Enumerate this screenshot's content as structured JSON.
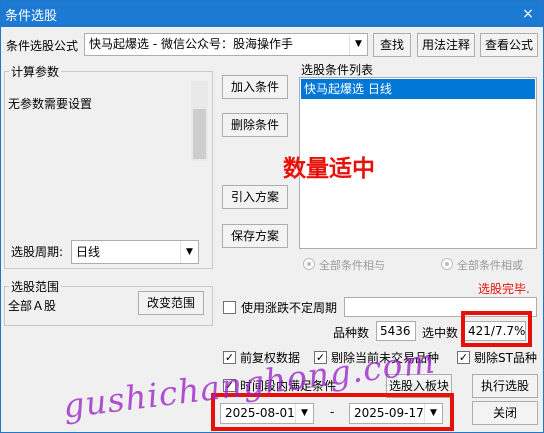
{
  "window": {
    "title": "条件选股",
    "close": "×"
  },
  "formula": {
    "label": "条件选股公式",
    "value": "快马起爆选 - 微信公众号：股海操作手",
    "find": "查找",
    "usage": "用法注释",
    "view": "查看公式"
  },
  "params": {
    "legend": "计算参数",
    "text": "无参数需要设置",
    "period_label": "选股周期:",
    "period_value": "日线"
  },
  "buttons": {
    "add": "加入条件",
    "delete": "删除条件",
    "import": "引入方案",
    "save": "保存方案"
  },
  "condition_list": {
    "label": "选股条件列表",
    "items": [
      "快马起爆选  日线"
    ]
  },
  "annotation": "数量适中",
  "logic": {
    "and": "全部条件相与",
    "or": "全部条件相或"
  },
  "status_text": "选股完毕.",
  "scope": {
    "legend": "选股范围",
    "value": "全部Ａ股",
    "change": "改变范围"
  },
  "period_check": {
    "label": "使用涨跌不定周期",
    "value": ""
  },
  "stats": {
    "count_label": "品种数",
    "count_value": "5436",
    "selected_label": "选中数",
    "selected_value": "421/7.7%"
  },
  "options": {
    "adjusted": "前复权数据",
    "exclude_untraded": "剔除当前未交易品种",
    "exclude_st": "剔除ST品种",
    "time_range": "时间段内满足条件"
  },
  "actions": {
    "to_block": "选股入板块",
    "execute": "执行选股",
    "close": "关闭"
  },
  "dates": {
    "start": "2025-08-01",
    "dash": "-",
    "end": "2025-09-17"
  },
  "watermark": "gushichanghong.com",
  "colors": {
    "title_bar": "#1c7ad3",
    "highlight": "#e8110a",
    "selection": "#0078d7",
    "status": "#e8110a"
  }
}
